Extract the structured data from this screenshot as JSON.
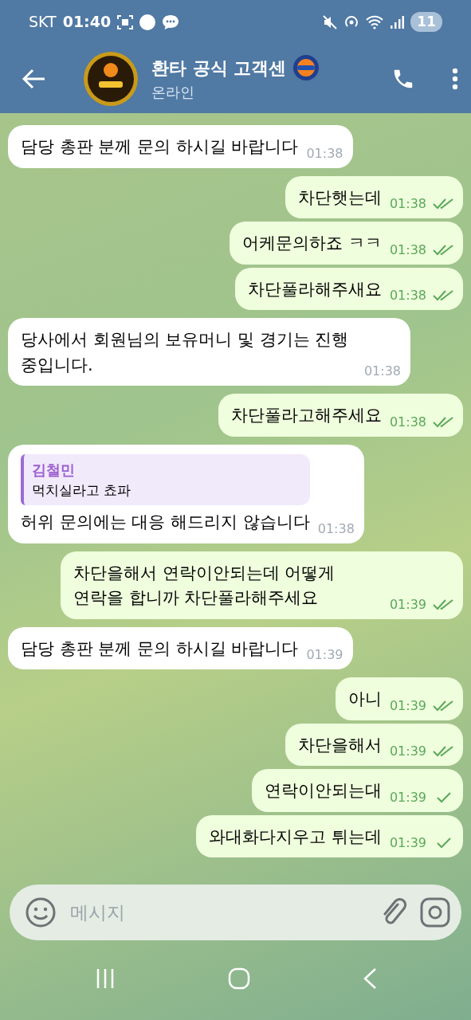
{
  "status_bar": {
    "carrier": "SKT",
    "time": "01:40",
    "battery": "11"
  },
  "header": {
    "title": "환타 공식 고객센",
    "status": "온라인"
  },
  "messages": [
    {
      "outgoing": false,
      "text": "담당 총판 분께 문의 하시길 바랍니다",
      "time": "01:38"
    },
    {
      "outgoing": true,
      "read": true,
      "text": "차단햇는데",
      "time": "01:38"
    },
    {
      "outgoing": true,
      "read": true,
      "text": "어케문의하죠 ㅋㅋ",
      "time": "01:38"
    },
    {
      "outgoing": true,
      "read": true,
      "text": "차단풀라해주새요",
      "time": "01:38"
    },
    {
      "outgoing": false,
      "text": "당사에서 회원님의 보유머니 및 경기는 진행 중입니다.",
      "time": "01:38"
    },
    {
      "outgoing": true,
      "read": true,
      "text": "차단풀라고해주세요",
      "time": "01:38"
    },
    {
      "outgoing": false,
      "reply": {
        "name": "김철민",
        "text": "먹치실라고 쵸파"
      },
      "text": "허위 문의에는 대응 해드리지 않습니다",
      "time": "01:38"
    },
    {
      "outgoing": true,
      "read": true,
      "text": "차단을해서 연락이안되는데 어떻게 연락을 합니까 차단풀라해주세요",
      "time": "01:39"
    },
    {
      "outgoing": false,
      "text": "담당 총판 분께 문의 하시길 바랍니다",
      "time": "01:39"
    },
    {
      "outgoing": true,
      "read": true,
      "text": "아니",
      "time": "01:39"
    },
    {
      "outgoing": true,
      "read": true,
      "text": "차단을해서",
      "time": "01:39"
    },
    {
      "outgoing": true,
      "read": false,
      "text": "연락이안되는대",
      "time": "01:39"
    },
    {
      "outgoing": true,
      "read": false,
      "text": "와대화다지우고 튀는데",
      "time": "01:39"
    }
  ],
  "composer": {
    "placeholder": "메시지"
  }
}
